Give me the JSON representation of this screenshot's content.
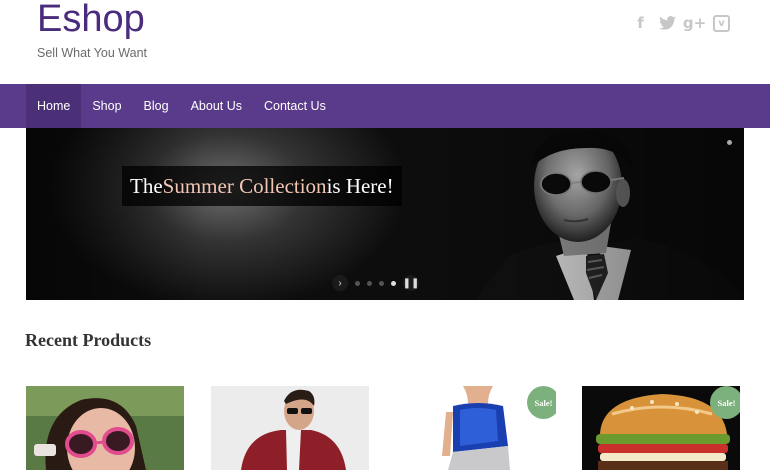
{
  "site": {
    "title": "Eshop",
    "tagline": "Sell What You Want"
  },
  "social": [
    {
      "name": "facebook-icon",
      "glyph": "f"
    },
    {
      "name": "twitter-icon",
      "glyph": "ᴛ"
    },
    {
      "name": "google-plus-icon",
      "glyph": "g+"
    },
    {
      "name": "vimeo-icon",
      "glyph": "v"
    }
  ],
  "nav": {
    "items": [
      {
        "label": "Home",
        "active": true
      },
      {
        "label": "Shop"
      },
      {
        "label": "Blog"
      },
      {
        "label": "About Us"
      },
      {
        "label": "Contact Us"
      }
    ]
  },
  "slider": {
    "caption_pre": "The ",
    "caption_highlight": "Summer Collection",
    "caption_post": " is Here!"
  },
  "products": {
    "title": "Recent Products",
    "items": [
      {
        "sale": false
      },
      {
        "sale": false
      },
      {
        "sale": true,
        "badge": "Sale!"
      },
      {
        "sale": true,
        "badge": "Sale!"
      }
    ]
  },
  "colors": {
    "brand": "#5a3a8a",
    "title": "#4a2c7d",
    "sale": "#7cb07c"
  }
}
